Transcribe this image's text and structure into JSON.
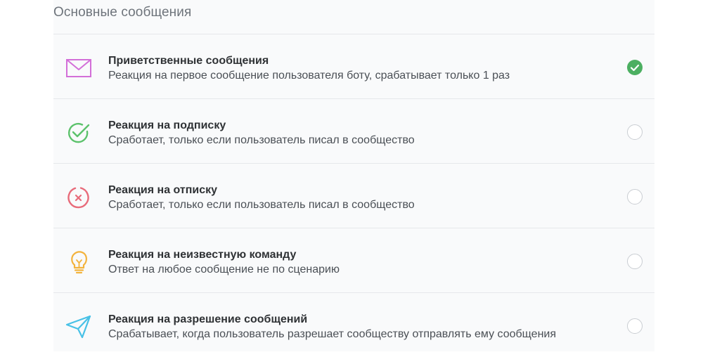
{
  "section": {
    "title": "Основные сообщения"
  },
  "items": [
    {
      "title": "Приветственные сообщения",
      "description": "Реакция на первое сообщение пользователя боту, срабатывает только 1 раз",
      "icon": "envelope-icon",
      "icon_color": "#d36fd8",
      "selected": true
    },
    {
      "title": "Реакция на подписку",
      "description": "Сработает, только если пользователь писал в сообщество",
      "icon": "check-circle-icon",
      "icon_color": "#5cc26b",
      "selected": false
    },
    {
      "title": "Реакция на отписку",
      "description": "Сработает, только если пользователь писал в сообщество",
      "icon": "x-circle-icon",
      "icon_color": "#e86b7a",
      "selected": false
    },
    {
      "title": "Реакция на неизвестную команду",
      "description": "Ответ на любое сообщение не по сценарию",
      "icon": "lightbulb-icon",
      "icon_color": "#f3b33d",
      "selected": false
    },
    {
      "title": "Реакция на разрешение сообщений",
      "description": "Срабатывает, когда пользователь разрешает сообществу отправлять ему сообщения",
      "icon": "paper-plane-icon",
      "icon_color": "#48c1e6",
      "selected": false
    }
  ],
  "colors": {
    "selected_radio": "#4caf61",
    "panel_background": "#f9fafb"
  }
}
